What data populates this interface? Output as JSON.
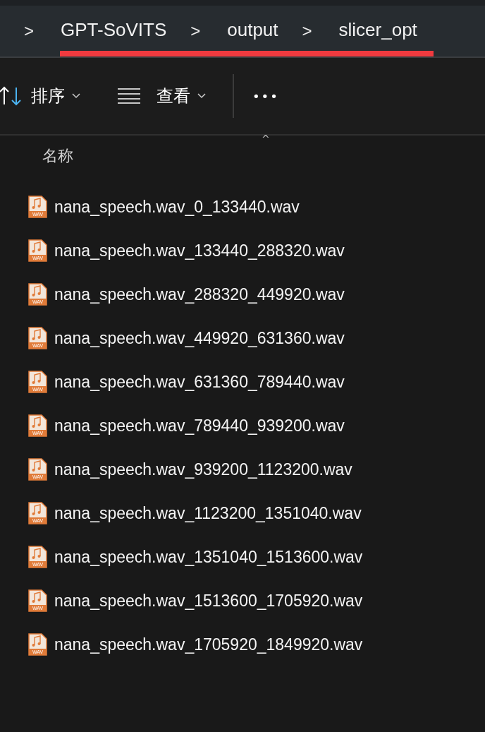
{
  "breadcrumb": {
    "separators": [
      ">",
      ">",
      ">"
    ],
    "items": [
      "GPT-SoVITS",
      "output",
      "slicer_opt"
    ]
  },
  "toolbar": {
    "sort": {
      "label": "排序"
    },
    "view": {
      "label": "查看"
    },
    "more": "•••"
  },
  "table": {
    "columns": [
      "名称"
    ],
    "sort_indicator": "^"
  },
  "files": [
    {
      "name": "nana_speech.wav_0_133440.wav",
      "icon_label": "WAV"
    },
    {
      "name": "nana_speech.wav_133440_288320.wav",
      "icon_label": "WAV"
    },
    {
      "name": "nana_speech.wav_288320_449920.wav",
      "icon_label": "WAV"
    },
    {
      "name": "nana_speech.wav_449920_631360.wav",
      "icon_label": "WAV"
    },
    {
      "name": "nana_speech.wav_631360_789440.wav",
      "icon_label": "WAV"
    },
    {
      "name": "nana_speech.wav_789440_939200.wav",
      "icon_label": "WAV"
    },
    {
      "name": "nana_speech.wav_939200_1123200.wav",
      "icon_label": "WAV"
    },
    {
      "name": "nana_speech.wav_1123200_1351040.wav",
      "icon_label": "WAV"
    },
    {
      "name": "nana_speech.wav_1351040_1513600.wav",
      "icon_label": "WAV"
    },
    {
      "name": "nana_speech.wav_1513600_1705920.wav",
      "icon_label": "WAV"
    },
    {
      "name": "nana_speech.wav_1705920_1849920.wav",
      "icon_label": "WAV"
    }
  ]
}
